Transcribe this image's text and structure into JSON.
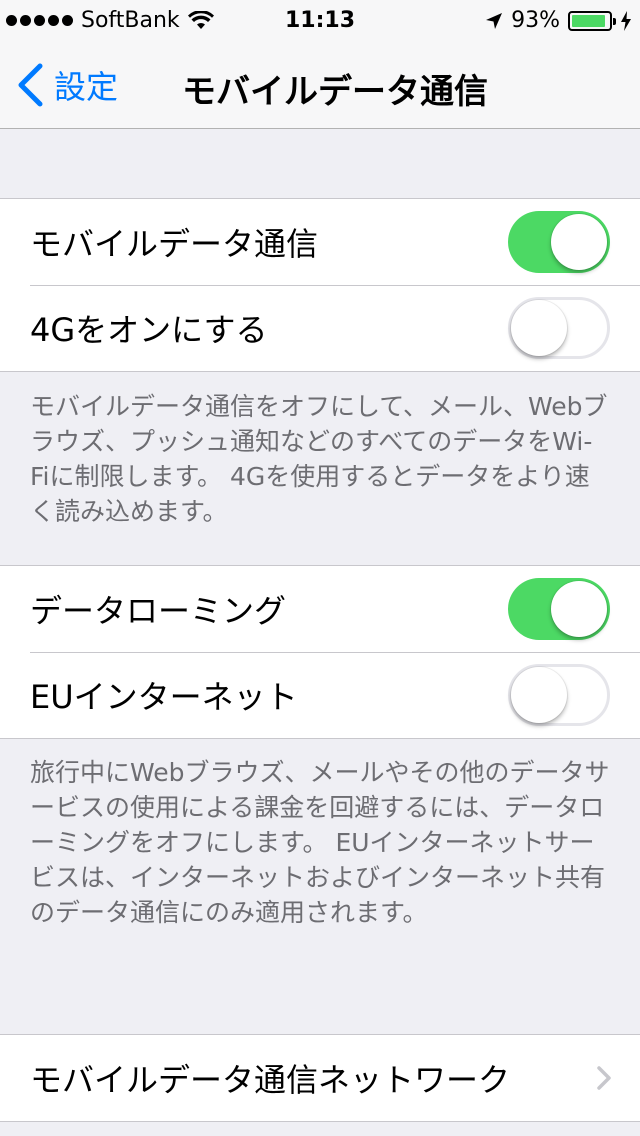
{
  "status_bar": {
    "carrier": "SoftBank",
    "time": "11:13",
    "battery_percent": "93%",
    "battery_level": 0.93,
    "signal_bars": 5,
    "icons": [
      "signal-dots-icon",
      "wifi-icon",
      "location-arrow-icon",
      "battery-icon",
      "charging-bolt-icon"
    ]
  },
  "nav": {
    "back_label": "設定",
    "title": "モバイルデータ通信"
  },
  "group1": {
    "cellular_data_label": "モバイルデータ通信",
    "cellular_data_on": true,
    "lte_label": "4Gをオンにする",
    "lte_on": false,
    "footer": "モバイルデータ通信をオフにして、メール、Webブラウズ、プッシュ通知などのすべてのデータをWi-Fiに制限します。 4Gを使用するとデータをより速く読み込めます。"
  },
  "group2": {
    "roaming_label": "データローミング",
    "roaming_on": true,
    "eu_label": "EUインターネット",
    "eu_on": false,
    "footer": "旅行中にWebブラウズ、メールやその他のデータサービスの使用による課金を回避するには、データローミングをオフにします。 EUインターネットサービスは、インターネットおよびインターネット共有のデータ通信にのみ適用されます。"
  },
  "group3": {
    "network_label": "モバイルデータ通信ネットワーク"
  },
  "colors": {
    "accent": "#007aff",
    "toggle_on": "#4cd964",
    "background": "#efeff4",
    "footer_text": "#6d6d72"
  }
}
